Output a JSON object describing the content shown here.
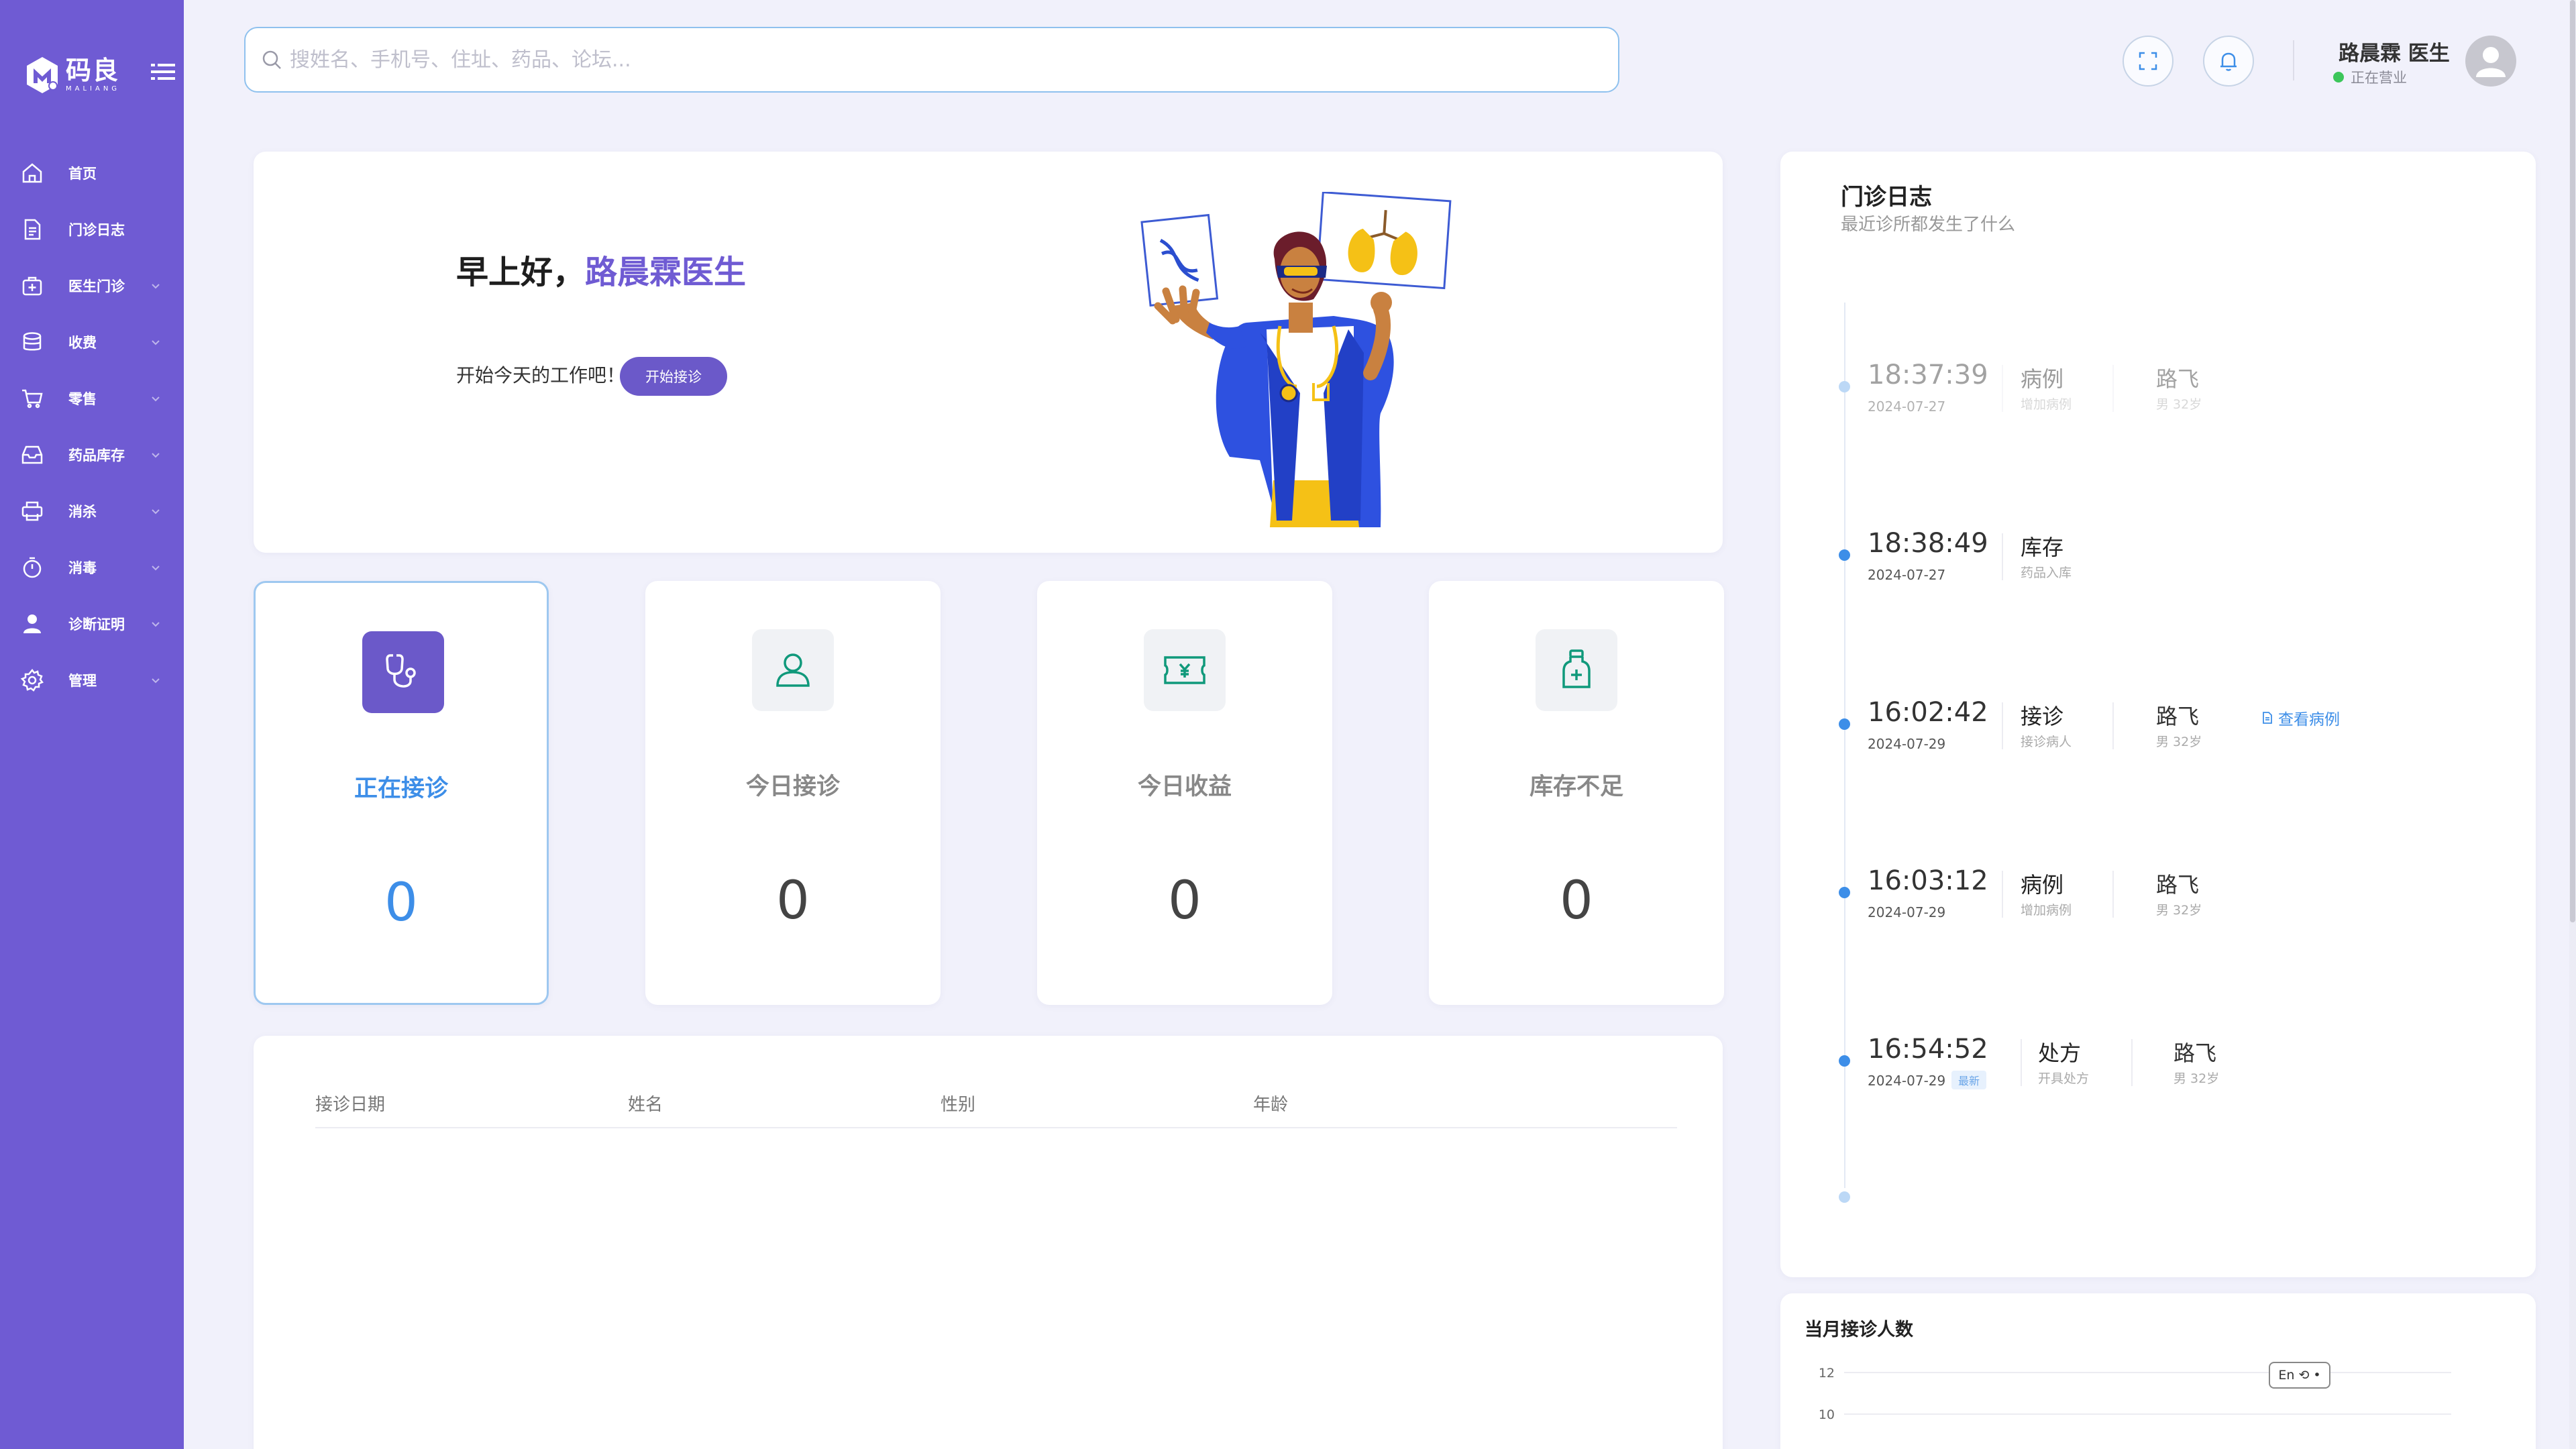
{
  "brand": {
    "name_cn": "码良",
    "name_en": "MALIANG"
  },
  "sidebar": {
    "items": [
      {
        "label": "首页",
        "icon": "home-icon",
        "has_submenu": false
      },
      {
        "label": "门诊日志",
        "icon": "document-icon",
        "has_submenu": false
      },
      {
        "label": "医生门诊",
        "icon": "medical-bag-icon",
        "has_submenu": true
      },
      {
        "label": "收费",
        "icon": "database-icon",
        "has_submenu": true
      },
      {
        "label": "零售",
        "icon": "cart-icon",
        "has_submenu": true
      },
      {
        "label": "药品库存",
        "icon": "inbox-icon",
        "has_submenu": true
      },
      {
        "label": "消杀",
        "icon": "printer-icon",
        "has_submenu": true
      },
      {
        "label": "消毒",
        "icon": "timer-icon",
        "has_submenu": true
      },
      {
        "label": "诊断证明",
        "icon": "user-icon",
        "has_submenu": true
      },
      {
        "label": "管理",
        "icon": "gear-icon",
        "has_submenu": true
      }
    ]
  },
  "search": {
    "placeholder": "搜姓名、手机号、住址、药品、论坛..."
  },
  "user": {
    "name": "路晨霖 医生",
    "status": "正在营业"
  },
  "welcome": {
    "greeting_prefix": "早上好，",
    "greeting_name": "路晨霖医生",
    "subtext": "开始今天的工作吧！",
    "start_button": "开始接诊"
  },
  "stats": [
    {
      "label": "正在接诊",
      "value": "0",
      "icon": "stethoscope-icon",
      "active": true
    },
    {
      "label": "今日接诊",
      "value": "0",
      "icon": "person-icon",
      "active": false
    },
    {
      "label": "今日收益",
      "value": "0",
      "icon": "yuan-ticket-icon",
      "active": false
    },
    {
      "label": "库存不足",
      "value": "0",
      "icon": "medicine-bottle-icon",
      "active": false
    }
  ],
  "table": {
    "columns": [
      "接诊日期",
      "姓名",
      "性别",
      "年龄"
    ],
    "rows": []
  },
  "timeline": {
    "title": "门诊日志",
    "subtitle": "最近诊所都发生了什么",
    "entries": [
      {
        "time": "18:37:39",
        "date": "2024-07-27",
        "event": "病例",
        "event_sub": "增加病例",
        "patient": "路飞",
        "patient_sub": "男 32岁",
        "faded": true
      },
      {
        "time": "18:38:49",
        "date": "2024-07-27",
        "event": "库存",
        "event_sub": "药品入库",
        "patient": "",
        "patient_sub": "",
        "faded": false
      },
      {
        "time": "16:02:42",
        "date": "2024-07-29",
        "event": "接诊",
        "event_sub": "接诊病人",
        "patient": "路飞",
        "patient_sub": "男 32岁",
        "link": "查看病例",
        "faded": false
      },
      {
        "time": "16:03:12",
        "date": "2024-07-29",
        "event": "病例",
        "event_sub": "增加病例",
        "patient": "路飞",
        "patient_sub": "男 32岁",
        "faded": false
      },
      {
        "time": "16:54:52",
        "date": "2024-07-29",
        "badge": "最新",
        "event": "处方",
        "event_sub": "开具处方",
        "patient": "路飞",
        "patient_sub": "男 32岁",
        "faded": false
      }
    ]
  },
  "monthly_chart": {
    "title": "当月接诊人数",
    "chip_label": "En",
    "chart_data": {
      "type": "line",
      "title": "当月接诊人数",
      "y_ticks": [
        12,
        10
      ],
      "series": []
    }
  },
  "colors": {
    "sidebar": "#6f5bd3",
    "accent": "#3d8ee8",
    "brand_purple": "#6b59c9",
    "status_green": "#3cc65a"
  }
}
